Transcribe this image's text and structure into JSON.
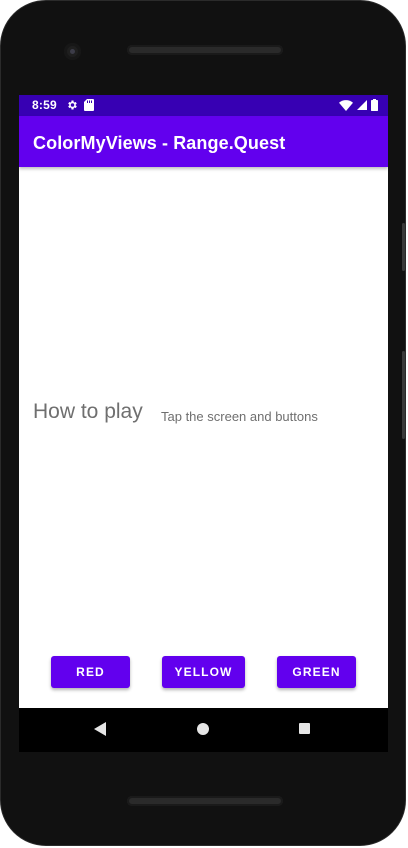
{
  "status_bar": {
    "time": "8:59",
    "background_color": "#3700b3",
    "left_icons": [
      "settings-gear-icon",
      "sd-card-icon"
    ],
    "right_icons": [
      "wifi-icon",
      "cellular-signal-icon",
      "battery-icon"
    ]
  },
  "app_bar": {
    "title": "ColorMyViews - Range.Quest",
    "background_color": "#6200ee"
  },
  "content": {
    "how_to_play": "How to play",
    "instructions": "Tap the screen and buttons"
  },
  "buttons": {
    "red_label": "RED",
    "yellow_label": "YELLOW",
    "green_label": "GREEN",
    "color": "#6200ee"
  },
  "navigation": {
    "icons": [
      "back-triangle-icon",
      "home-circle-icon",
      "recents-square-icon"
    ]
  }
}
